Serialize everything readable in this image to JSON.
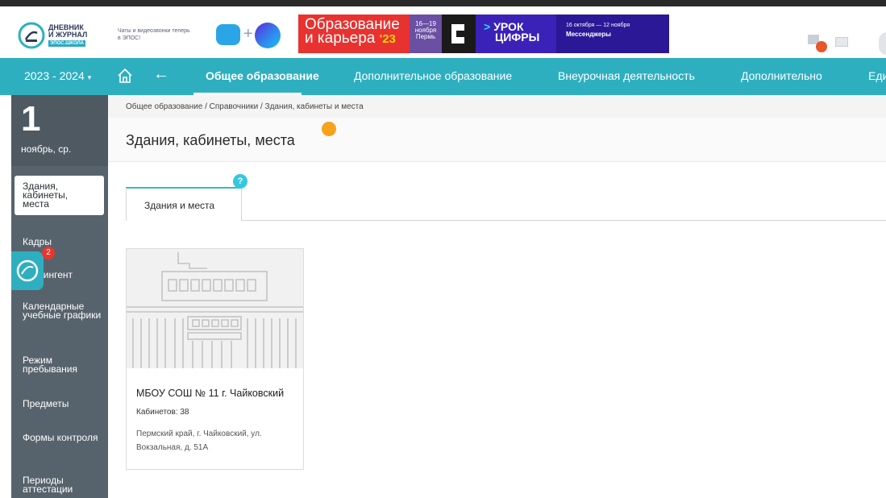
{
  "logo": {
    "line1": "ДНЕВНИК",
    "line2": "И ЖУРНАЛ",
    "line3": "ЭПОС.ШКОЛА"
  },
  "banner": {
    "chat_text": "Чаты и видеозвонки теперь в ЭПОС!",
    "plus": "+",
    "edu_line1": "Образование",
    "edu_line2": "и карьера",
    "edu_year": "'23",
    "date_days": "16—19",
    "date_month": "ноября",
    "date_city": "Пермь",
    "urok_line1": "УРОК",
    "urok_line2": "ЦИФРЫ",
    "mess_dates": "16 октября — 12 ноября",
    "mess_title": "Мессенджеры"
  },
  "header": {
    "notification_badge": "!"
  },
  "nav": {
    "year": "2023 - 2024",
    "caret": "▾",
    "back": "←",
    "tabs": [
      {
        "label": "Общее образование",
        "active": true
      },
      {
        "label": "Дополнительное образование"
      },
      {
        "label": "Внеурочная деятельность"
      },
      {
        "label": "Дополнительно"
      },
      {
        "label": "Еди"
      }
    ]
  },
  "sidebar": {
    "day": "1",
    "date_label": "ноябрь, ср.",
    "floating_badge": "2",
    "items": [
      {
        "label": "Здания, кабинеты, места",
        "active": true
      },
      {
        "label": "Кадры"
      },
      {
        "label": "Контингент"
      },
      {
        "label": "Календарные учебные графики"
      },
      {
        "label": "Режим пребывания"
      },
      {
        "label": "Предметы"
      },
      {
        "label": "Формы контроля"
      },
      {
        "label": "Периоды аттестации"
      }
    ]
  },
  "content": {
    "breadcrumb": "Общее образование / Справочники / Здания, кабинеты и места",
    "title": "Здания, кабинеты, места",
    "tab_label": "Здания и места",
    "help": "?",
    "building": {
      "name": "МБОУ СОШ № 11 г. Чайковский",
      "rooms": "Кабинетов: 38",
      "address": "Пермский край, г. Чайковский, ул. Вокзальная, д. 51А"
    }
  },
  "colors": {
    "accent": "#2eafc0",
    "sidebar": "#57636c",
    "orange": "#f7a21b",
    "badge": "#e8362f"
  }
}
